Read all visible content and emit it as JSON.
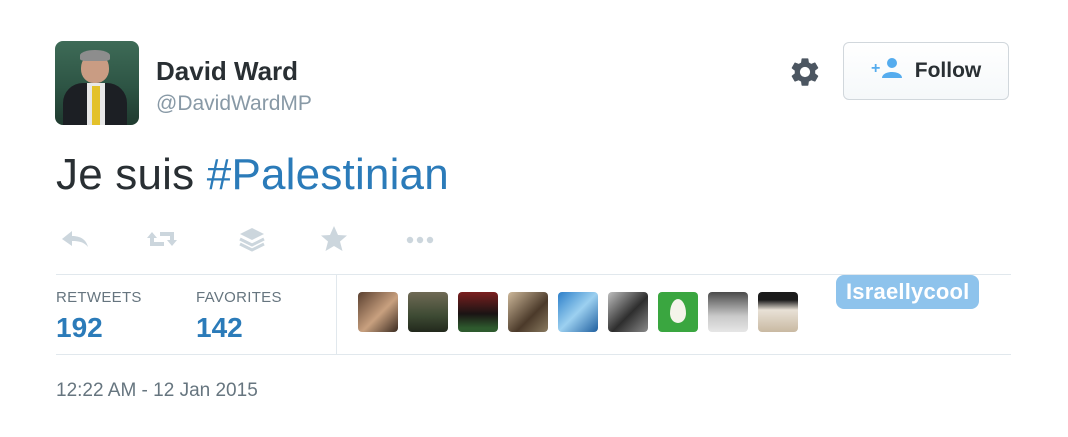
{
  "author": {
    "name": "David Ward",
    "handle": "@DavidWardMP"
  },
  "follow_button": {
    "label": "Follow",
    "icon": "follow-user-icon"
  },
  "settings": {
    "icon": "gear-icon"
  },
  "tweet": {
    "text_prefix": "Je suis ",
    "hashtag": "#Palestinian"
  },
  "actions": [
    {
      "name": "reply",
      "icon": "reply-icon"
    },
    {
      "name": "retweet",
      "icon": "retweet-icon"
    },
    {
      "name": "buffer",
      "icon": "layers-icon"
    },
    {
      "name": "favorite",
      "icon": "star-icon"
    },
    {
      "name": "more",
      "icon": "ellipsis-icon"
    }
  ],
  "stats": {
    "retweets_label": "RETWEETS",
    "retweets_value": "192",
    "favorites_label": "FAVORITES",
    "favorites_value": "142"
  },
  "watermark": "Israellycool",
  "timestamp": "12:22 AM - 12 Jan 2015",
  "colors": {
    "link_blue": "#2b7bb9",
    "muted_gray": "#8899a6",
    "watermark_bg": "#8ec3ec"
  }
}
